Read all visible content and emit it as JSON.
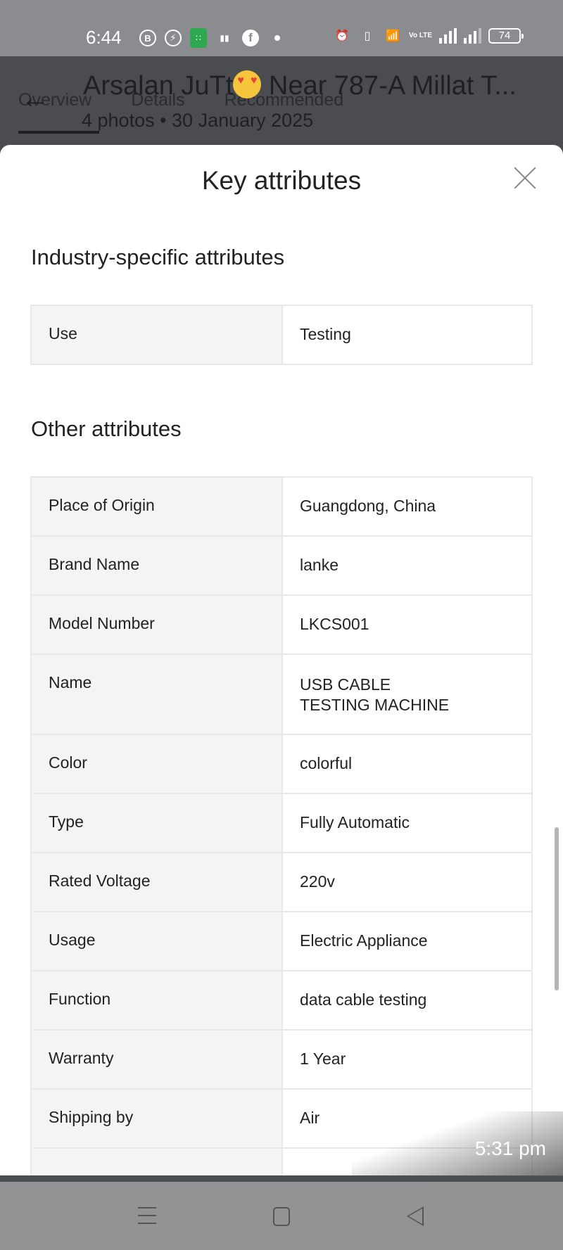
{
  "status_bar": {
    "time": "6:44",
    "left_icons": [
      "business-chat-icon",
      "messenger-icon",
      "app-notification-icon",
      "data-sim-icon",
      "facebook-icon",
      "more-notifications-dot"
    ],
    "right_icons": [
      "alarm-icon",
      "vibrate-icon",
      "wifi-icon",
      "volte-icon",
      "signal-1-icon",
      "signal-2-icon"
    ],
    "volte_label": "Vo LTE",
    "battery": "74"
  },
  "chat_header": {
    "title": "Arsalan JuTt",
    "title_suffix": " Near 787-A Millat T...",
    "subtitle": "4 photos  •  30 January 2025"
  },
  "page_tabs": [
    {
      "label": "Overview",
      "active": true
    },
    {
      "label": "Details",
      "active": false
    },
    {
      "label": "Recommended",
      "active": false
    }
  ],
  "sheet": {
    "title": "Key attributes",
    "sections": [
      {
        "heading": "Industry-specific attributes",
        "rows": [
          {
            "key": "Use",
            "value": "Testing"
          }
        ]
      },
      {
        "heading": "Other attributes",
        "rows": [
          {
            "key": "Place of Origin",
            "value": "Guangdong, China"
          },
          {
            "key": "Brand Name",
            "value": "lanke"
          },
          {
            "key": "Model Number",
            "value": "LKCS001"
          },
          {
            "key": "Name",
            "value": "USB CABLE TESTING MACHINE"
          },
          {
            "key": "Color",
            "value": "colorful"
          },
          {
            "key": "Type",
            "value": "Fully Automatic"
          },
          {
            "key": "Rated Voltage",
            "value": "220v"
          },
          {
            "key": "Usage",
            "value": "Electric Appliance"
          },
          {
            "key": "Function",
            "value": "data cable testing"
          },
          {
            "key": "Warranty",
            "value": "1 Year"
          },
          {
            "key": "Shipping by",
            "value": "Air"
          },
          {
            "key": "",
            "value": ""
          }
        ]
      }
    ]
  },
  "image_timestamp": "5:31 pm",
  "nav_bar": [
    "recents-icon",
    "home-icon",
    "back-icon"
  ]
}
